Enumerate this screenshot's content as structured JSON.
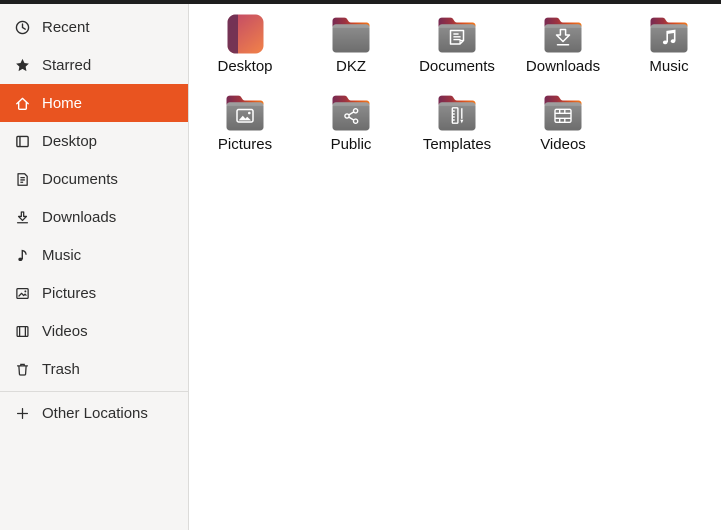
{
  "colors": {
    "accent": "#E95420",
    "accent_text": "#FFFFFF",
    "topbar": "#1E1E1E",
    "sidebar_bg": "#F6F5F4",
    "sidebar_border": "#DCDBD9",
    "sidebar_text": "#2E2E2E",
    "main_bg": "#FFFFFF",
    "label_text": "#111111",
    "folder_front_top": "#8F8F8F",
    "folder_front_bottom": "#6D6D6D",
    "folder_flap_left": "#772A52",
    "folder_flap_right": "#F1791E",
    "desktop_icon_left": "#6C3054",
    "desktop_icon_gradient_start": "#BF4668",
    "desktop_icon_gradient_end": "#EC7C4C"
  },
  "sidebar": {
    "items": [
      {
        "id": "recent",
        "label": "Recent",
        "icon": "clock-icon",
        "selected": false
      },
      {
        "id": "starred",
        "label": "Starred",
        "icon": "star-icon",
        "selected": false
      },
      {
        "id": "home",
        "label": "Home",
        "icon": "home-icon",
        "selected": true
      },
      {
        "id": "desktop",
        "label": "Desktop",
        "icon": "desktop-panel-icon",
        "selected": false
      },
      {
        "id": "documents",
        "label": "Documents",
        "icon": "document-icon",
        "selected": false
      },
      {
        "id": "downloads",
        "label": "Downloads",
        "icon": "download-icon",
        "selected": false
      },
      {
        "id": "music",
        "label": "Music",
        "icon": "music-note-icon",
        "selected": false
      },
      {
        "id": "pictures",
        "label": "Pictures",
        "icon": "image-icon",
        "selected": false
      },
      {
        "id": "videos",
        "label": "Videos",
        "icon": "film-icon",
        "selected": false
      },
      {
        "id": "trash",
        "label": "Trash",
        "icon": "trash-icon",
        "selected": false
      }
    ],
    "bottom_items": [
      {
        "id": "other-locations",
        "label": "Other Locations",
        "icon": "plus-icon",
        "selected": false
      }
    ]
  },
  "files": {
    "view": "grid",
    "items": [
      {
        "id": "desktop",
        "name": "Desktop",
        "icon": "desktop-folder-icon"
      },
      {
        "id": "dkz",
        "name": "DKZ",
        "icon": "folder-icon"
      },
      {
        "id": "documents",
        "name": "Documents",
        "icon": "folder-documents-icon"
      },
      {
        "id": "downloads",
        "name": "Downloads",
        "icon": "folder-downloads-icon"
      },
      {
        "id": "music",
        "name": "Music",
        "icon": "folder-music-icon"
      },
      {
        "id": "pictures",
        "name": "Pictures",
        "icon": "folder-pictures-icon"
      },
      {
        "id": "public",
        "name": "Public",
        "icon": "folder-share-icon"
      },
      {
        "id": "templates",
        "name": "Templates",
        "icon": "folder-templates-icon"
      },
      {
        "id": "videos",
        "name": "Videos",
        "icon": "folder-videos-icon"
      }
    ]
  }
}
